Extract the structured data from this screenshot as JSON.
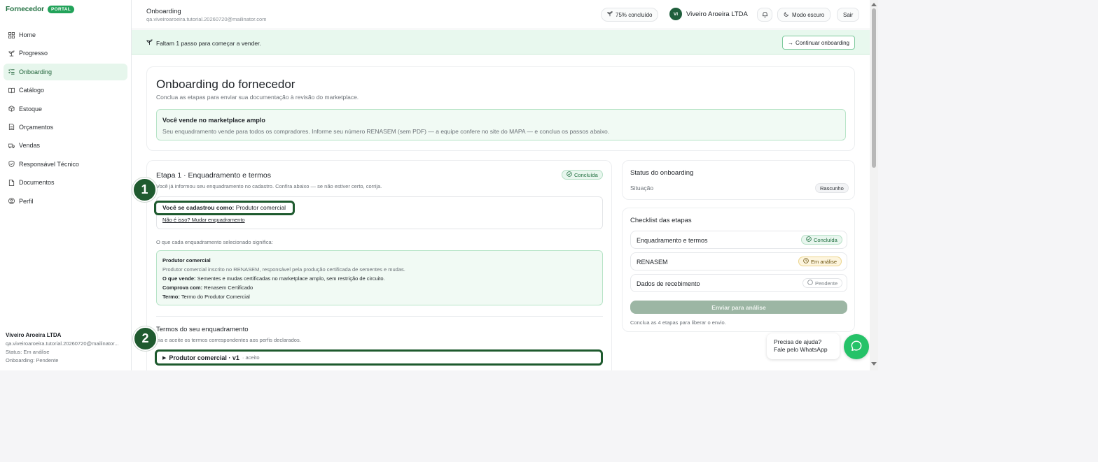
{
  "sidebar": {
    "brand": "Fornecedor",
    "brand_badge": "PORTAL",
    "items": [
      {
        "label": "Home",
        "icon": "grid-icon"
      },
      {
        "label": "Progresso",
        "icon": "sprout-icon"
      },
      {
        "label": "Onboarding",
        "icon": "list-check-icon",
        "active": true
      },
      {
        "label": "Catálogo",
        "icon": "book-icon"
      },
      {
        "label": "Estoque",
        "icon": "boxes-icon"
      },
      {
        "label": "Orçamentos",
        "icon": "file-icon"
      },
      {
        "label": "Vendas",
        "icon": "truck-icon"
      },
      {
        "label": "Responsável Técnico",
        "icon": "shield-icon"
      },
      {
        "label": "Documentos",
        "icon": "document-icon"
      },
      {
        "label": "Perfil",
        "icon": "user-circle-icon"
      }
    ],
    "footer": {
      "name": "Viveiro Aroeira LTDA",
      "email": "qa.viveiroaroeira.tutorial.20260720@mailinator...",
      "status": "Status: Em análise",
      "onboarding": "Onboarding: Pendente"
    }
  },
  "header": {
    "title": "Onboarding",
    "email": "qa.viveiroaroeira.tutorial.20260720@mailinator.com",
    "progress_label": "75% concluído",
    "avatar_initials": "VI",
    "user_name": "Viveiro Aroeira LTDA",
    "dark_mode_label": "Modo escuro",
    "logout_label": "Sair"
  },
  "banner": {
    "text": "Faltam 1 passo para começar a vender.",
    "button_label": "Continuar onboarding"
  },
  "hero": {
    "title": "Onboarding do fornecedor",
    "subtitle": "Conclua as etapas para enviar sua documentação à revisão do marketplace.",
    "info_title": "Você vende no marketplace amplo",
    "info_text": "Seu enquadramento vende para todos os compradores. Informe seu número RENASEM (sem PDF) — a equipe confere no site do MAPA — e conclua os passos abaixo."
  },
  "step1": {
    "title": "Etapa 1 · Enquadramento e termos",
    "status": "Concluída",
    "subtitle": "Você já informou seu enquadramento no cadastro. Confira abaixo — se não estiver certo, corrija.",
    "registered_prefix": "Você se cadastrou como:",
    "registered_value": "Produtor comercial",
    "change_link": "Não é isso? Mudar enquadramento",
    "meaning_label": "O que cada enquadramento selecionado significa:",
    "meaning": {
      "title": "Produtor comercial",
      "desc": "Produtor comercial inscrito no RENASEM, responsável pela produção certificada de sementes e mudas.",
      "sells_label": "O que vende:",
      "sells_value": "Sementes e mudas certificadas no marketplace amplo, sem restrição de circuito.",
      "proves_label": "Comprova com:",
      "proves_value": "Renasem Certificado",
      "term_label": "Termo:",
      "term_value": "Termo do Produtor Comercial"
    },
    "terms_title": "Termos do seu enquadramento",
    "terms_subtitle": "eia e aceite os termos correspondentes aos perfis declarados.",
    "terms_item": "Produtor comercial · v1",
    "terms_item_status": "· aceito"
  },
  "status_card": {
    "title": "Status do onboarding",
    "label": "Situação",
    "value": "Rascunho"
  },
  "checklist": {
    "title": "Checklist das etapas",
    "items": [
      {
        "label": "Enquadramento e termos",
        "status": "Concluída",
        "kind": "ok"
      },
      {
        "label": "RENASEM",
        "status": "Em análise",
        "kind": "warn"
      },
      {
        "label": "Dados de recebimento",
        "status": "Pendente",
        "kind": "pend"
      }
    ],
    "button_label": "Enviar para análise",
    "note": "Conclua as 4 etapas para liberar o envio."
  },
  "help": {
    "line1": "Precisa de ajuda?",
    "line2": "Fale pelo WhatsApp"
  },
  "markers": [
    "1",
    "2"
  ],
  "colors": {
    "accent": "#22a35a",
    "dark_green": "#1e5a2e",
    "banner_bg": "#e8f8ee"
  }
}
